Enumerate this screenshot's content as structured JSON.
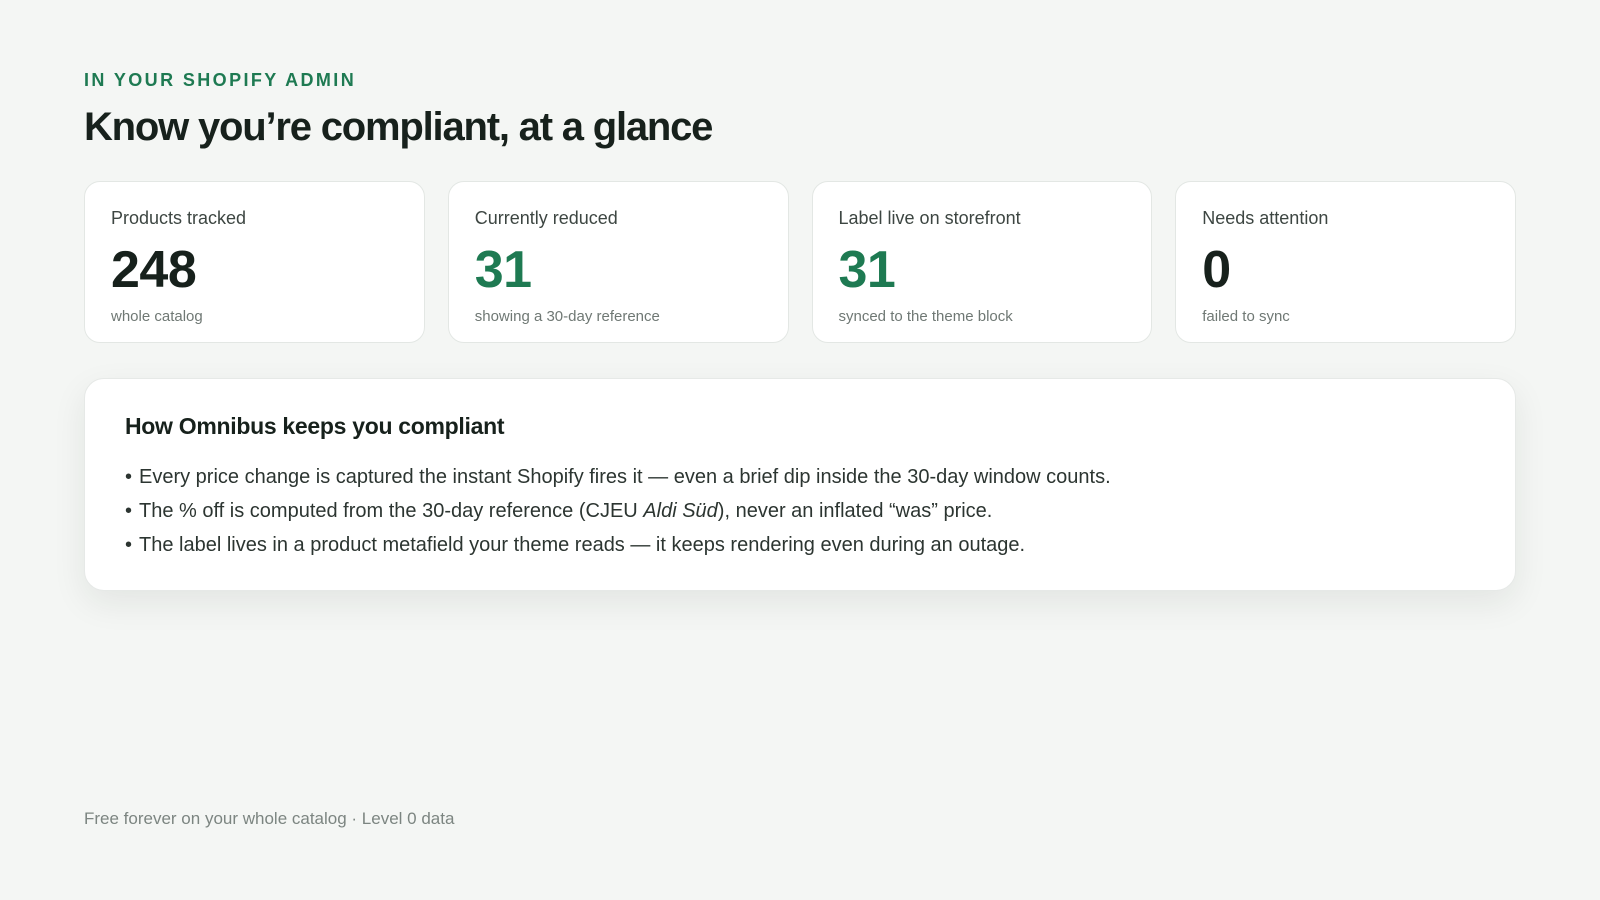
{
  "header": {
    "eyebrow": "IN YOUR SHOPIFY ADMIN",
    "title": "Know you’re compliant, at a glance"
  },
  "stats": [
    {
      "label": "Products tracked",
      "value": "248",
      "sub": "whole catalog",
      "accent": false
    },
    {
      "label": "Currently reduced",
      "value": "31",
      "sub": "showing a 30-day reference",
      "accent": true
    },
    {
      "label": "Label live on storefront",
      "value": "31",
      "sub": "synced to the theme block",
      "accent": true
    },
    {
      "label": "Needs attention",
      "value": "0",
      "sub": "failed to sync",
      "accent": false
    }
  ],
  "info": {
    "title": "How Omnibus keeps you compliant",
    "bullet_char": "•",
    "items": [
      {
        "text": "Every price change is captured the instant Shopify fires it — even a brief dip inside the 30-day window counts."
      },
      {
        "before": "The % off is computed from the 30-day reference (CJEU ",
        "emphasis": "Aldi Süd",
        "after": "), never an inflated “was” price."
      },
      {
        "text": "The label lives in a product metafield your theme reads — it keeps rendering even during an outage."
      }
    ]
  },
  "footer": {
    "note": "Free forever on your whole catalog · Level 0 data"
  },
  "colors": {
    "accent": "#1e7a52",
    "text": "#17211c",
    "background": "#f4f6f4"
  }
}
